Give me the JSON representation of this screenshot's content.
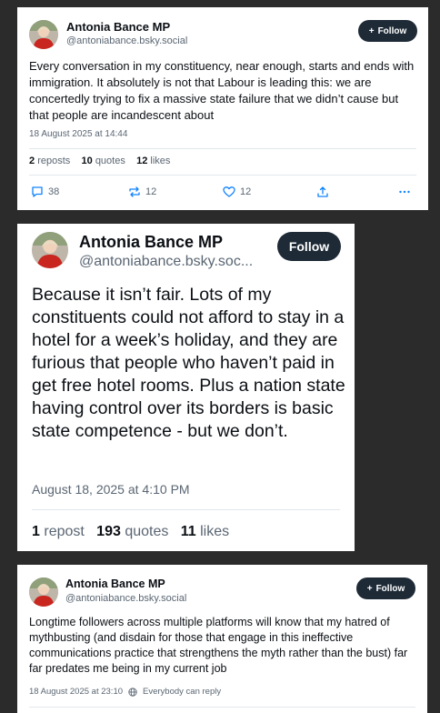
{
  "posts": [
    {
      "author": "Antonia Bance MP",
      "handle": "@antoniabance.bsky.social",
      "follow_label": "Follow",
      "text": "Every conversation in my constituency, near enough, starts and ends with immigration. It absolutely is not that Labour is leading this: we are concertedly trying to fix a massive state failure that we didn’t cause but that people are incandescent about",
      "timestamp": "18 August 2025 at 14:44",
      "reposts_count": "2",
      "reposts_label": "reposts",
      "quotes_count": "10",
      "quotes_label": "quotes",
      "likes_count": "12",
      "likes_label": "likes",
      "actions": {
        "reply_count": "38",
        "repost_count": "12",
        "like_count": "12"
      }
    },
    {
      "author": "Antonia Bance MP",
      "handle": "@antoniabance.bsky.soc...",
      "follow_label": "Follow",
      "text": "Because it isn’t fair. Lots of my constituents could not afford to stay in a hotel for a week’s holiday, and they are furious that people who haven’t paid in get free hotel rooms. Plus a nation state having control over its borders is basic state competence - but we don’t.",
      "timestamp": "August 18, 2025 at 4:10 PM",
      "reposts_count": "1",
      "reposts_label": "repost",
      "quotes_count": "193",
      "quotes_label": "quotes",
      "likes_count": "11",
      "likes_label": "likes"
    },
    {
      "author": "Antonia Bance MP",
      "handle": "@antoniabance.bsky.social",
      "follow_label": "Follow",
      "text": "Longtime followers across multiple platforms will know that my hatred of mythbusting (and disdain for those that engage in this ineffective communications practice that strengthens the myth rather than the bust) far far predates me being in my current job",
      "timestamp": "18 August 2025 at 23:10",
      "reply_setting": "Everybody can reply"
    }
  ],
  "colors": {
    "background": "#2b2b2b",
    "card": "#ffffff",
    "accent": "#1083fe",
    "follow_button": "#1e2a36"
  }
}
